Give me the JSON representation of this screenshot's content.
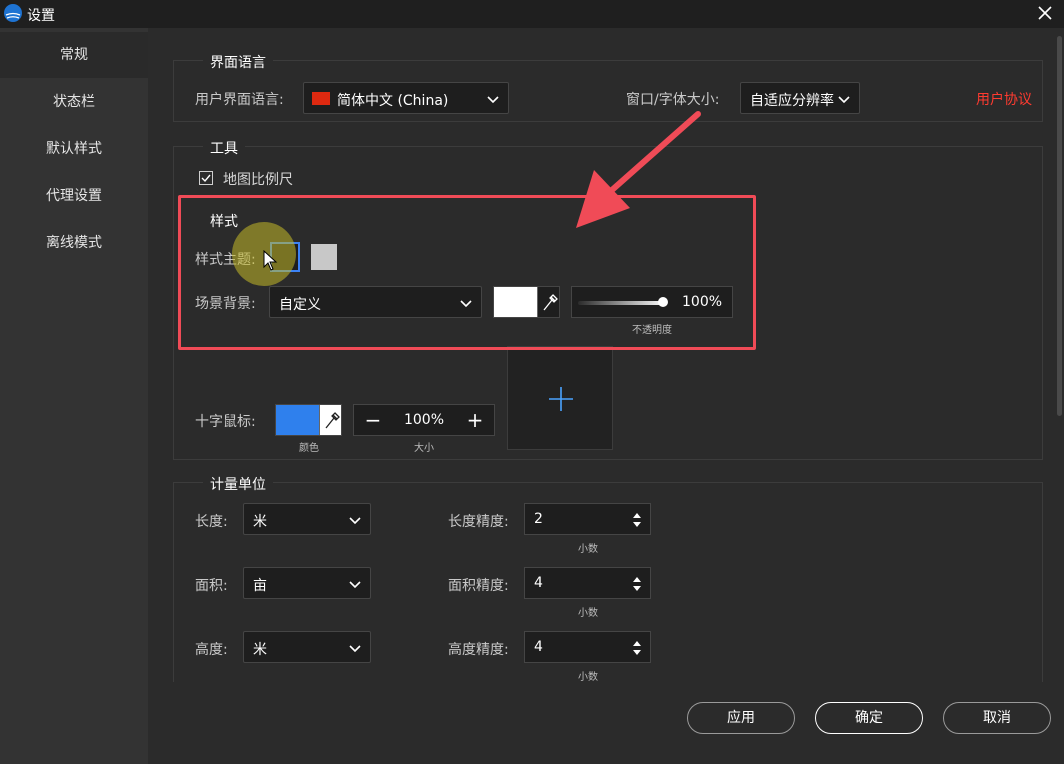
{
  "window": {
    "title": "设置"
  },
  "sidebar": {
    "items": [
      {
        "label": "常规"
      },
      {
        "label": "状态栏"
      },
      {
        "label": "默认样式"
      },
      {
        "label": "代理设置"
      },
      {
        "label": "离线模式"
      }
    ]
  },
  "interface": {
    "title": "界面语言",
    "lang_label": "用户界面语言:",
    "lang_value": "简体中文 (China)",
    "font_label": "窗口/字体大小:",
    "font_value": "自适应分辨率",
    "agreement_link": "用户协议"
  },
  "tools": {
    "title": "工具",
    "scale_label": "地图比例尺",
    "scale_checked": true
  },
  "style": {
    "title": "样式",
    "theme_label": "样式主题:",
    "scene_label": "场景背景:",
    "scene_value": "自定义",
    "scene_color": "#ffffff",
    "opacity_value": "100%",
    "opacity_caption": "不透明度",
    "cross_label": "十字鼠标:",
    "cross_color": "#2f80ed",
    "cross_color_caption": "颜色",
    "cross_size_value": "100%",
    "cross_size_caption": "大小"
  },
  "units": {
    "title": "计量单位",
    "length_label": "长度:",
    "length_value": "米",
    "length_prec_label": "长度精度:",
    "length_prec_value": "2",
    "area_label": "面积:",
    "area_value": "亩",
    "area_prec_label": "面积精度:",
    "area_prec_value": "4",
    "height_label": "高度:",
    "height_value": "米",
    "height_prec_label": "高度精度:",
    "height_prec_value": "4",
    "decimal_caption": "小数"
  },
  "footer": {
    "apply": "应用",
    "ok": "确定",
    "cancel": "取消"
  },
  "colors": {
    "accent": "#3b82f6",
    "annotation": "#f04b57",
    "link": "#ff3b30"
  }
}
